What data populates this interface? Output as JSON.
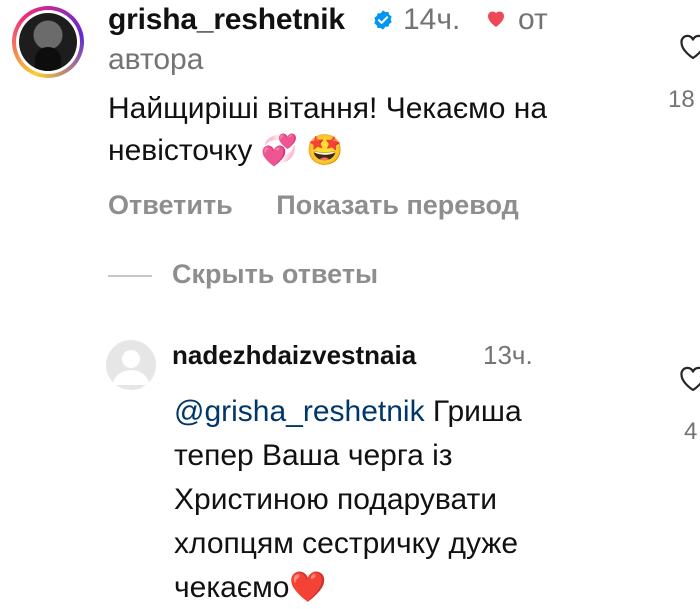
{
  "comment": {
    "username": "grisha_reshetnik",
    "time": "14ч.",
    "from_author_line1": "от",
    "from_author_line2": "автора",
    "text_line1": "Найщиріші вітання! Чекаємо на",
    "text_line2": "невісточку 💞 🤩",
    "like_count": "18",
    "actions": {
      "reply_label": "Ответить",
      "translate_label": "Показать перевод"
    }
  },
  "replies": {
    "toggle_label": "Скрыть ответы"
  },
  "reply": {
    "username": "nadezhdaizvestnaia",
    "time": "13ч.",
    "mention": "@grisha_reshetnik",
    "text_after_mention": " Гриша",
    "line2": "тепер Ваша черга із",
    "line3": "Христиною подарувати",
    "line4": "хлопцям сестричку дуже",
    "line5": "чекаємо❤️",
    "like_count": "4"
  },
  "colors": {
    "secondary_text": "#737373",
    "action_text": "#8e8e8e",
    "mention": "#00376b",
    "verified_badge": "#0095f6",
    "heart": "#ed4956"
  },
  "icons": {
    "verified": "verified-badge-icon",
    "author_liked": "heart-icon",
    "like": "heart-outline-icon"
  }
}
